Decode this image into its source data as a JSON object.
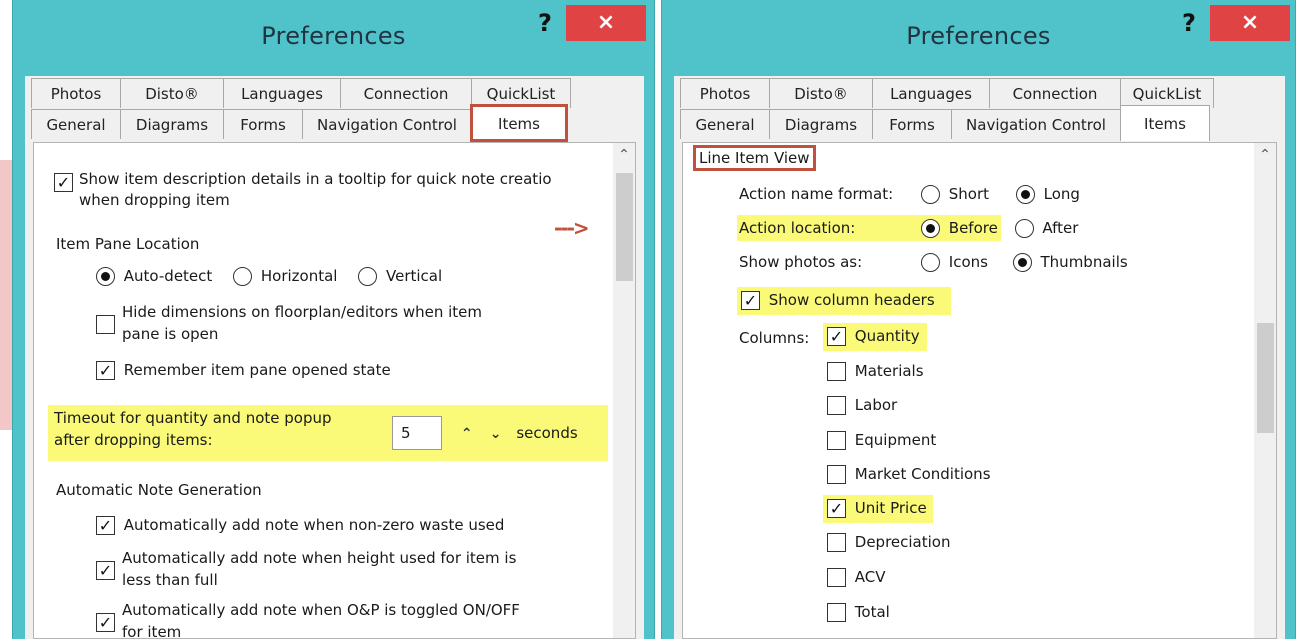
{
  "left": {
    "title": "Preferences",
    "help": "?",
    "close": "×",
    "tabs_top": [
      "Photos",
      "Disto®",
      "Languages",
      "Connection",
      "QuickList"
    ],
    "tabs_bottom": [
      "General",
      "Diagrams",
      "Forms",
      "Navigation Control",
      "Items"
    ],
    "tooltip_option": {
      "checked": true,
      "line1": "Show item description details in a tooltip for quick note creatio",
      "line2": "when dropping item"
    },
    "pane_location": {
      "heading": "Item Pane Location",
      "options": [
        {
          "label": "Auto-detect",
          "selected": true
        },
        {
          "label": "Horizontal",
          "selected": false
        },
        {
          "label": "Vertical",
          "selected": false
        }
      ]
    },
    "hide_dimensions": {
      "checked": false,
      "line1": "Hide dimensions on floorplan/editors when item",
      "line2": "pane is open"
    },
    "remember_pane": {
      "checked": true,
      "label": "Remember item pane opened state"
    },
    "timeout": {
      "line1": "Timeout for quantity and note popup",
      "line2": "after dropping items:",
      "value": "5",
      "units": "seconds"
    },
    "note_generation": {
      "heading": "Automatic Note Generation",
      "waste": {
        "checked": true,
        "label": "Automatically add note when non-zero waste used"
      },
      "height": {
        "checked": true,
        "line1": "Automatically add note when height used for item is",
        "line2": "less than full"
      },
      "op": {
        "checked": true,
        "line1": "Automatically add note when O&P is toggled ON/OFF",
        "line2": "for item"
      }
    }
  },
  "right": {
    "title": "Preferences",
    "help": "?",
    "close": "×",
    "tabs_top": [
      "Photos",
      "Disto®",
      "Languages",
      "Connection",
      "QuickList"
    ],
    "tabs_bottom": [
      "General",
      "Diagrams",
      "Forms",
      "Navigation Control",
      "Items"
    ],
    "section": "Line Item View",
    "action_name": {
      "label": "Action name format:",
      "options": [
        {
          "label": "Short",
          "selected": false
        },
        {
          "label": "Long",
          "selected": true
        }
      ]
    },
    "action_location": {
      "label": "Action location:",
      "options": [
        {
          "label": "Before",
          "selected": true
        },
        {
          "label": "After",
          "selected": false
        }
      ]
    },
    "photos_as": {
      "label": "Show photos as:",
      "options": [
        {
          "label": "Icons",
          "selected": false
        },
        {
          "label": "Thumbnails",
          "selected": true
        }
      ]
    },
    "column_headers": {
      "checked": true,
      "label": "Show column headers"
    },
    "columns_label": "Columns:",
    "columns": [
      {
        "label": "Quantity",
        "checked": true
      },
      {
        "label": "Materials",
        "checked": false
      },
      {
        "label": "Labor",
        "checked": false
      },
      {
        "label": "Equipment",
        "checked": false
      },
      {
        "label": "Market Conditions",
        "checked": false
      },
      {
        "label": "Unit Price",
        "checked": true
      },
      {
        "label": "Depreciation",
        "checked": false
      },
      {
        "label": "ACV",
        "checked": false
      },
      {
        "label": "Total",
        "checked": false
      }
    ]
  },
  "annotation_arrow": "--->",
  "colors": {
    "window_frame": "#4fc3c9",
    "close_button": "#e04343",
    "highlight": "#fafa78",
    "callout_box": "#c0513d"
  }
}
